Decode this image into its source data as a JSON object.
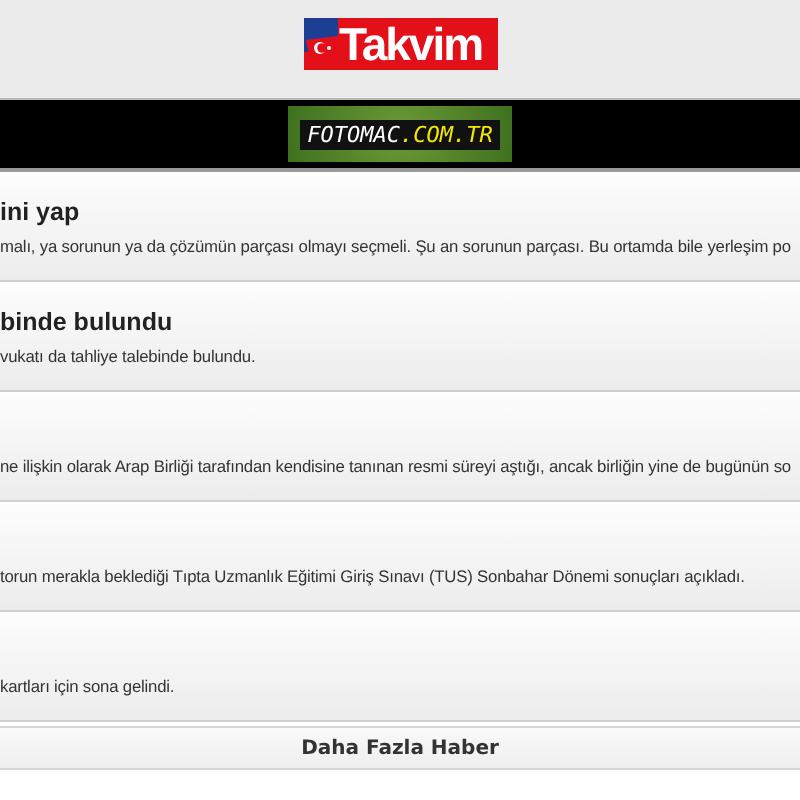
{
  "header": {
    "logo": "Takvim"
  },
  "banner": {
    "logo_main": "FOTOMAC",
    "logo_suffix": ".COM.TR"
  },
  "news": [
    {
      "title": "ini yap",
      "summary": "malı, ya sorunun ya da çözümün parçası olmayı seçmeli. Şu an sorunun parçası. Bu ortamda bile yerleşim po"
    },
    {
      "title": "binde bulundu",
      "summary": "vukatı da tahliye talebinde bulundu."
    },
    {
      "summary": "ne ilişkin olarak Arap Birliği tarafından kendisine tanınan resmi süreyi aştığı, ancak birliğin yine de bugünün so"
    },
    {
      "summary": "torun merakla beklediği Tıpta Uzmanlık Eğitimi Giriş Sınavı (TUS) Sonbahar Dönemi sonuçları açıkladı."
    },
    {
      "summary": "kartları için sona gelindi."
    }
  ],
  "more_button": "Daha Fazla Haber"
}
